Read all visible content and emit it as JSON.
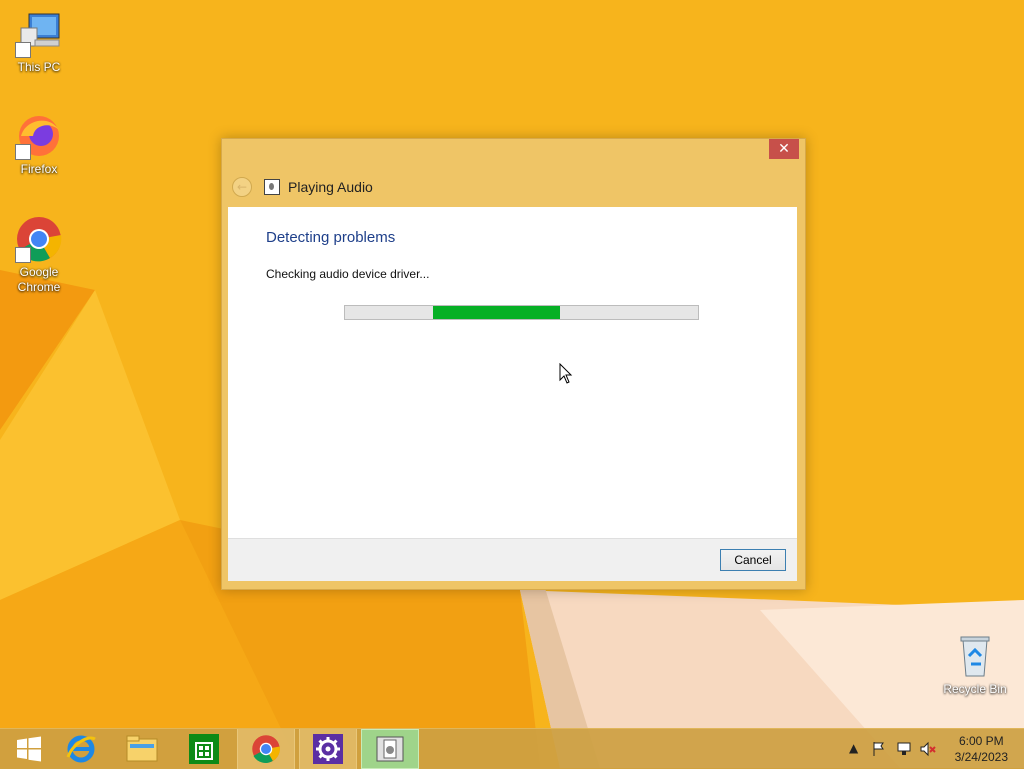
{
  "desktop": {
    "icons": [
      {
        "label": "This PC"
      },
      {
        "label": "Firefox"
      },
      {
        "label": "Google Chrome"
      },
      {
        "label": "Recycle Bin"
      }
    ]
  },
  "dialog": {
    "title": "Playing Audio",
    "close_label": "✕",
    "heading": "Detecting problems",
    "status": "Checking audio device driver...",
    "progress_segment": {
      "start": 0.25,
      "end": 0.61
    },
    "cancel_label": "Cancel"
  },
  "taskbar": {
    "apps": [
      "start",
      "internet-explorer",
      "file-explorer",
      "store",
      "chrome",
      "control-panel",
      "troubleshooter"
    ],
    "clock_time": "6:00 PM",
    "clock_date": "3/24/2023"
  },
  "colors": {
    "accent": "#f7b51a",
    "progress": "#06b025",
    "heading": "#1e3f8a"
  }
}
